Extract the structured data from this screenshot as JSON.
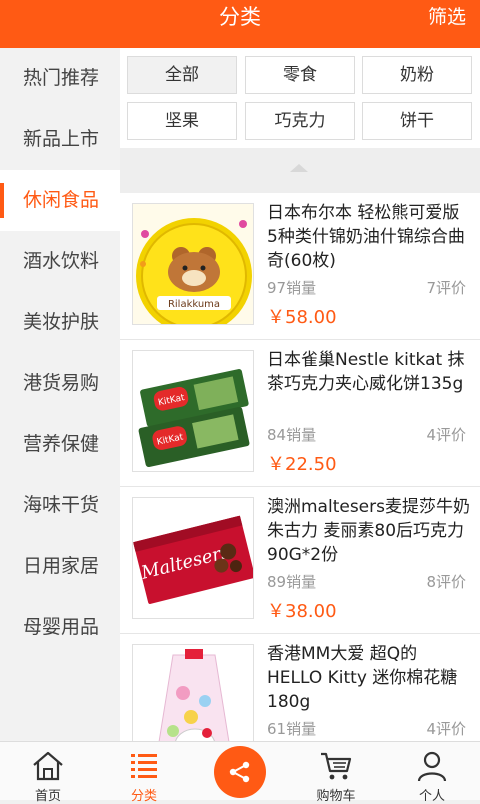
{
  "header": {
    "title": "分类",
    "filter_label": "筛选"
  },
  "sidebar": {
    "items": [
      {
        "label": "热门推荐"
      },
      {
        "label": "新品上市"
      },
      {
        "label": "休闲食品",
        "active": true
      },
      {
        "label": "酒水饮料"
      },
      {
        "label": "美妆护肤"
      },
      {
        "label": "港货易购"
      },
      {
        "label": "营养保健"
      },
      {
        "label": "海味干货"
      },
      {
        "label": "日用家居"
      },
      {
        "label": "母婴用品"
      }
    ]
  },
  "filters": [
    {
      "label": "全部",
      "selected": true
    },
    {
      "label": "零食"
    },
    {
      "label": "奶粉"
    },
    {
      "label": "坚果"
    },
    {
      "label": "巧克力"
    },
    {
      "label": "饼干"
    }
  ],
  "products": [
    {
      "title": "日本布尔本 轻松熊可爱版 5种类什锦奶油什锦综合曲奇(60枚)",
      "sales": "97销量",
      "reviews": "7评价",
      "price": "￥58.00",
      "brand_text": "Rilakkuma"
    },
    {
      "title": "日本雀巢Nestle kitkat 抹茶巧克力夹心威化饼135g",
      "sales": "84销量",
      "reviews": "4评价",
      "price": "￥22.50",
      "brand_text": "KitKat"
    },
    {
      "title": "澳洲maltesers麦提莎牛奶朱古力 麦丽素80后巧克力90G*2份",
      "sales": "89销量",
      "reviews": "8评价",
      "price": "￥38.00",
      "brand_text": "Maltesers"
    },
    {
      "title": "香港MM大爱 超Q的HELLO Kitty 迷你棉花糖180g",
      "sales": "61销量",
      "reviews": "4评价",
      "price": "",
      "brand_text": ""
    }
  ],
  "tabbar": {
    "tabs": [
      {
        "label": "首页",
        "icon": "home-icon"
      },
      {
        "label": "分类",
        "icon": "category-icon",
        "active": true
      },
      {
        "label": "",
        "icon": "share-icon"
      },
      {
        "label": "购物车",
        "icon": "cart-icon"
      },
      {
        "label": "个人",
        "icon": "person-icon"
      }
    ]
  },
  "colors": {
    "accent": "#ff5a14",
    "sidebar_bg": "#f2f2f2",
    "muted_text": "#999999"
  }
}
